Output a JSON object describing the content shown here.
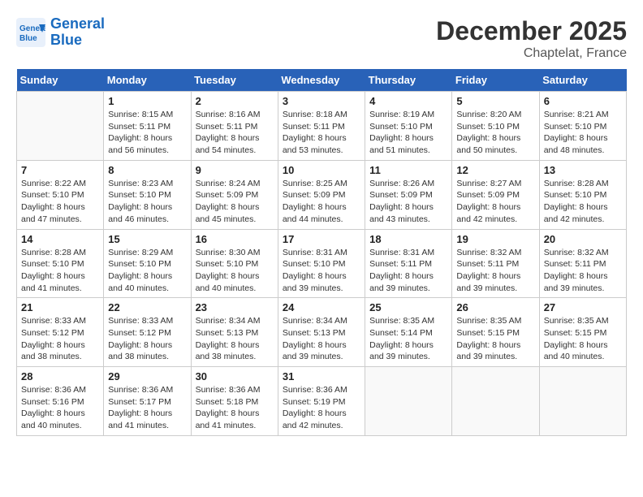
{
  "header": {
    "logo_line1": "General",
    "logo_line2": "Blue",
    "month": "December 2025",
    "location": "Chaptelat, France"
  },
  "weekdays": [
    "Sunday",
    "Monday",
    "Tuesday",
    "Wednesday",
    "Thursday",
    "Friday",
    "Saturday"
  ],
  "weeks": [
    [
      {
        "day": "",
        "sunrise": "",
        "sunset": "",
        "daylight": ""
      },
      {
        "day": "1",
        "sunrise": "Sunrise: 8:15 AM",
        "sunset": "Sunset: 5:11 PM",
        "daylight": "Daylight: 8 hours and 56 minutes."
      },
      {
        "day": "2",
        "sunrise": "Sunrise: 8:16 AM",
        "sunset": "Sunset: 5:11 PM",
        "daylight": "Daylight: 8 hours and 54 minutes."
      },
      {
        "day": "3",
        "sunrise": "Sunrise: 8:18 AM",
        "sunset": "Sunset: 5:11 PM",
        "daylight": "Daylight: 8 hours and 53 minutes."
      },
      {
        "day": "4",
        "sunrise": "Sunrise: 8:19 AM",
        "sunset": "Sunset: 5:10 PM",
        "daylight": "Daylight: 8 hours and 51 minutes."
      },
      {
        "day": "5",
        "sunrise": "Sunrise: 8:20 AM",
        "sunset": "Sunset: 5:10 PM",
        "daylight": "Daylight: 8 hours and 50 minutes."
      },
      {
        "day": "6",
        "sunrise": "Sunrise: 8:21 AM",
        "sunset": "Sunset: 5:10 PM",
        "daylight": "Daylight: 8 hours and 48 minutes."
      }
    ],
    [
      {
        "day": "7",
        "sunrise": "Sunrise: 8:22 AM",
        "sunset": "Sunset: 5:10 PM",
        "daylight": "Daylight: 8 hours and 47 minutes."
      },
      {
        "day": "8",
        "sunrise": "Sunrise: 8:23 AM",
        "sunset": "Sunset: 5:10 PM",
        "daylight": "Daylight: 8 hours and 46 minutes."
      },
      {
        "day": "9",
        "sunrise": "Sunrise: 8:24 AM",
        "sunset": "Sunset: 5:09 PM",
        "daylight": "Daylight: 8 hours and 45 minutes."
      },
      {
        "day": "10",
        "sunrise": "Sunrise: 8:25 AM",
        "sunset": "Sunset: 5:09 PM",
        "daylight": "Daylight: 8 hours and 44 minutes."
      },
      {
        "day": "11",
        "sunrise": "Sunrise: 8:26 AM",
        "sunset": "Sunset: 5:09 PM",
        "daylight": "Daylight: 8 hours and 43 minutes."
      },
      {
        "day": "12",
        "sunrise": "Sunrise: 8:27 AM",
        "sunset": "Sunset: 5:09 PM",
        "daylight": "Daylight: 8 hours and 42 minutes."
      },
      {
        "day": "13",
        "sunrise": "Sunrise: 8:28 AM",
        "sunset": "Sunset: 5:10 PM",
        "daylight": "Daylight: 8 hours and 42 minutes."
      }
    ],
    [
      {
        "day": "14",
        "sunrise": "Sunrise: 8:28 AM",
        "sunset": "Sunset: 5:10 PM",
        "daylight": "Daylight: 8 hours and 41 minutes."
      },
      {
        "day": "15",
        "sunrise": "Sunrise: 8:29 AM",
        "sunset": "Sunset: 5:10 PM",
        "daylight": "Daylight: 8 hours and 40 minutes."
      },
      {
        "day": "16",
        "sunrise": "Sunrise: 8:30 AM",
        "sunset": "Sunset: 5:10 PM",
        "daylight": "Daylight: 8 hours and 40 minutes."
      },
      {
        "day": "17",
        "sunrise": "Sunrise: 8:31 AM",
        "sunset": "Sunset: 5:10 PM",
        "daylight": "Daylight: 8 hours and 39 minutes."
      },
      {
        "day": "18",
        "sunrise": "Sunrise: 8:31 AM",
        "sunset": "Sunset: 5:11 PM",
        "daylight": "Daylight: 8 hours and 39 minutes."
      },
      {
        "day": "19",
        "sunrise": "Sunrise: 8:32 AM",
        "sunset": "Sunset: 5:11 PM",
        "daylight": "Daylight: 8 hours and 39 minutes."
      },
      {
        "day": "20",
        "sunrise": "Sunrise: 8:32 AM",
        "sunset": "Sunset: 5:11 PM",
        "daylight": "Daylight: 8 hours and 39 minutes."
      }
    ],
    [
      {
        "day": "21",
        "sunrise": "Sunrise: 8:33 AM",
        "sunset": "Sunset: 5:12 PM",
        "daylight": "Daylight: 8 hours and 38 minutes."
      },
      {
        "day": "22",
        "sunrise": "Sunrise: 8:33 AM",
        "sunset": "Sunset: 5:12 PM",
        "daylight": "Daylight: 8 hours and 38 minutes."
      },
      {
        "day": "23",
        "sunrise": "Sunrise: 8:34 AM",
        "sunset": "Sunset: 5:13 PM",
        "daylight": "Daylight: 8 hours and 38 minutes."
      },
      {
        "day": "24",
        "sunrise": "Sunrise: 8:34 AM",
        "sunset": "Sunset: 5:13 PM",
        "daylight": "Daylight: 8 hours and 39 minutes."
      },
      {
        "day": "25",
        "sunrise": "Sunrise: 8:35 AM",
        "sunset": "Sunset: 5:14 PM",
        "daylight": "Daylight: 8 hours and 39 minutes."
      },
      {
        "day": "26",
        "sunrise": "Sunrise: 8:35 AM",
        "sunset": "Sunset: 5:15 PM",
        "daylight": "Daylight: 8 hours and 39 minutes."
      },
      {
        "day": "27",
        "sunrise": "Sunrise: 8:35 AM",
        "sunset": "Sunset: 5:15 PM",
        "daylight": "Daylight: 8 hours and 40 minutes."
      }
    ],
    [
      {
        "day": "28",
        "sunrise": "Sunrise: 8:36 AM",
        "sunset": "Sunset: 5:16 PM",
        "daylight": "Daylight: 8 hours and 40 minutes."
      },
      {
        "day": "29",
        "sunrise": "Sunrise: 8:36 AM",
        "sunset": "Sunset: 5:17 PM",
        "daylight": "Daylight: 8 hours and 41 minutes."
      },
      {
        "day": "30",
        "sunrise": "Sunrise: 8:36 AM",
        "sunset": "Sunset: 5:18 PM",
        "daylight": "Daylight: 8 hours and 41 minutes."
      },
      {
        "day": "31",
        "sunrise": "Sunrise: 8:36 AM",
        "sunset": "Sunset: 5:19 PM",
        "daylight": "Daylight: 8 hours and 42 minutes."
      },
      {
        "day": "",
        "sunrise": "",
        "sunset": "",
        "daylight": ""
      },
      {
        "day": "",
        "sunrise": "",
        "sunset": "",
        "daylight": ""
      },
      {
        "day": "",
        "sunrise": "",
        "sunset": "",
        "daylight": ""
      }
    ]
  ]
}
